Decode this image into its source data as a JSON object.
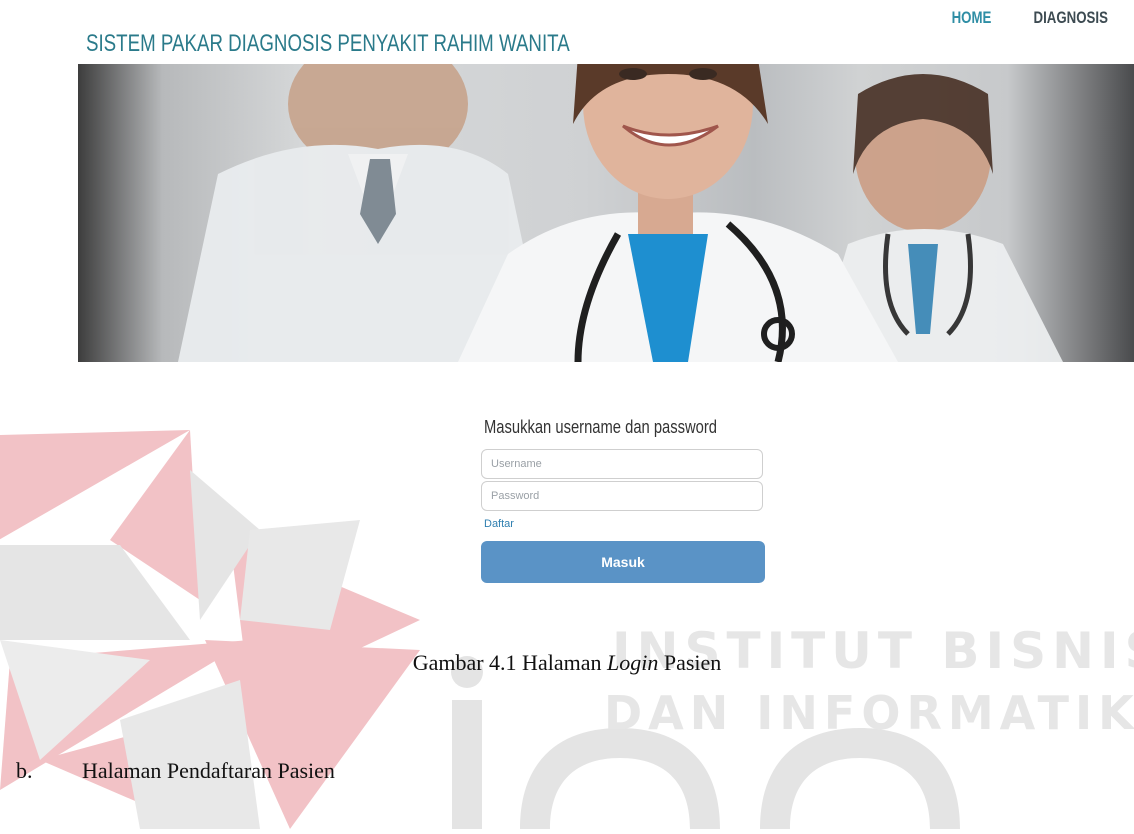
{
  "watermark": {
    "line1": "INSTITUT BISNIS",
    "line2": "DAN INFORMATIKA",
    "brand": "stikom"
  },
  "header": {
    "title": "SISTEM PAKAR DIAGNOSIS PENYAKIT RAHIM WANITA",
    "nav": [
      {
        "label": "HOME",
        "active": true
      },
      {
        "label": "DIAGNOSIS",
        "active": false
      }
    ]
  },
  "hero": {
    "image": "doctors-banner"
  },
  "login": {
    "heading": "Masukkan username dan password",
    "username_placeholder": "Username",
    "password_placeholder": "Password",
    "register_link": "Daftar",
    "submit_label": "Masuk"
  },
  "document": {
    "caption_prefix": "Gambar 4.1 Halaman ",
    "caption_italic": "Login",
    "caption_suffix": " Pasien",
    "section_number": "b.",
    "section_title": "Halaman Pendaftaran Pasien"
  },
  "colors": {
    "title": "#2a7a8a",
    "nav_active": "#2f8ea5",
    "nav_inactive": "#3d4b52",
    "button": "#5a93c6",
    "watermark_red": "#f2c2c6",
    "watermark_grey": "#e3e3e3"
  }
}
